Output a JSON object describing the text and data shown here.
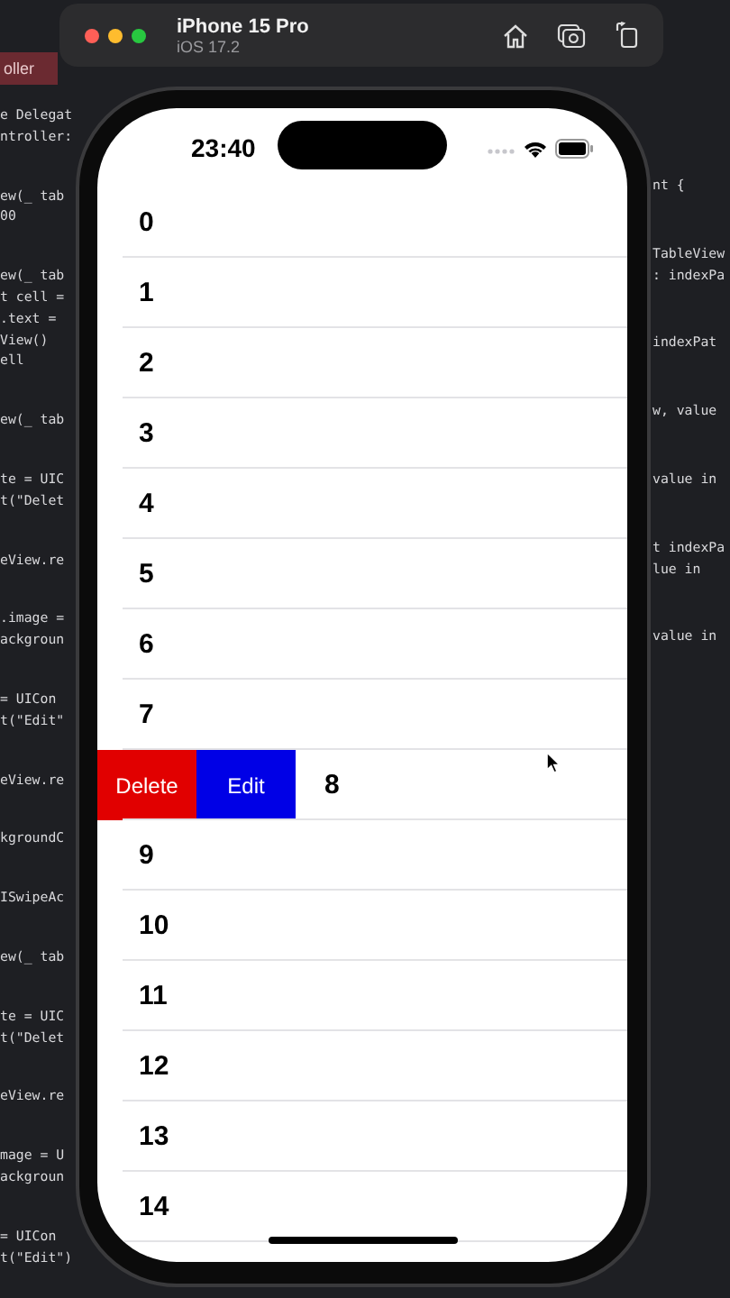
{
  "editor": {
    "tab": "oller",
    "left_code": [
      [
        "e Delegat",
        "ntroller:"
      ],
      [
        "ew(_ tab",
        "00"
      ],
      [
        "ew(_ tab",
        "t cell =",
        ".text =",
        "View()",
        "ell"
      ],
      [
        "ew(_ tab"
      ],
      [
        "te = UIC",
        "t(\"Delet"
      ],
      [
        "eView.re"
      ],
      [
        ".image =",
        "ackgroun"
      ],
      [
        "= UICon",
        "t(\"Edit\""
      ],
      [
        "eView.re"
      ],
      [
        "kgroundC"
      ],
      [
        "ISwipeAc"
      ],
      [
        "ew(_ tab"
      ],
      [
        "te = UIC",
        "t(\"Delet"
      ],
      [
        "eView.re"
      ],
      [
        "mage = U",
        "ackgroun"
      ],
      [
        "= UICon",
        "t(\"Edit\")"
      ]
    ],
    "right_code": [
      [
        "nt {"
      ],
      [
        "TableView",
        ": indexPa"
      ],
      [
        "indexPat"
      ],
      [
        "w, value"
      ],
      [
        "value in"
      ],
      [
        "t indexPa",
        "lue in"
      ],
      [
        "value in"
      ]
    ]
  },
  "simulator": {
    "title": "iPhone 15 Pro",
    "subtitle": "iOS 17.2"
  },
  "phone": {
    "time": "23:40",
    "rows": [
      {
        "label": "0",
        "swiped": false
      },
      {
        "label": "1",
        "swiped": false
      },
      {
        "label": "2",
        "swiped": false
      },
      {
        "label": "3",
        "swiped": false
      },
      {
        "label": "4",
        "swiped": false
      },
      {
        "label": "5",
        "swiped": false
      },
      {
        "label": "6",
        "swiped": false
      },
      {
        "label": "7",
        "swiped": false
      },
      {
        "label": "8",
        "swiped": true
      },
      {
        "label": "9",
        "swiped": false
      },
      {
        "label": "10",
        "swiped": false
      },
      {
        "label": "11",
        "swiped": false
      },
      {
        "label": "12",
        "swiped": false
      },
      {
        "label": "13",
        "swiped": false
      },
      {
        "label": "14",
        "swiped": false
      }
    ],
    "swipe_actions": [
      {
        "label": "Delete",
        "kind": "destructive"
      },
      {
        "label": "Edit",
        "kind": "normal"
      }
    ]
  }
}
